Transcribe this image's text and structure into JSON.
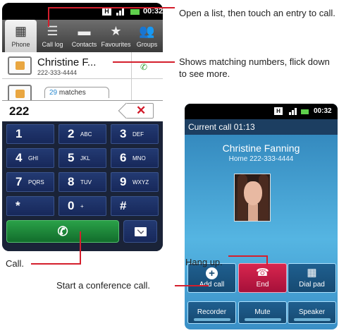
{
  "dialer": {
    "status": {
      "h_badge": "H",
      "time": "00:32"
    },
    "tabs": [
      {
        "label": "Phone",
        "icon": "keypad-icon",
        "active": true
      },
      {
        "label": "Call log",
        "icon": "list-icon"
      },
      {
        "label": "Contacts",
        "icon": "contacts-icon"
      },
      {
        "label": "Favourites",
        "icon": "star-icon"
      },
      {
        "label": "Groups",
        "icon": "groups-icon"
      }
    ],
    "entry": {
      "name": "Christine F...",
      "number": "222-333-4444"
    },
    "matches": {
      "count": "29",
      "label": "matches"
    },
    "input": {
      "value": "222",
      "delete_symbol": "✕"
    },
    "keys": [
      {
        "digit": "1",
        "letters": ""
      },
      {
        "digit": "2",
        "letters": "ABC"
      },
      {
        "digit": "3",
        "letters": "DEF"
      },
      {
        "digit": "4",
        "letters": "GHI"
      },
      {
        "digit": "5",
        "letters": "JKL"
      },
      {
        "digit": "6",
        "letters": "MNO"
      },
      {
        "digit": "7",
        "letters": "PQRS"
      },
      {
        "digit": "8",
        "letters": "TUV"
      },
      {
        "digit": "9",
        "letters": "WXYZ"
      },
      {
        "digit": "*",
        "letters": ""
      },
      {
        "digit": "0",
        "letters": "+"
      },
      {
        "digit": "#",
        "letters": ""
      }
    ]
  },
  "incall": {
    "status": {
      "h_badge": "H",
      "time": "00:32"
    },
    "current_call": "Current call 01:13",
    "contact_name": "Christine Fanning",
    "contact_number": "Home 222-333-4444",
    "buttons": {
      "add_call": "Add call",
      "end": "End",
      "dial_pad": "Dial pad",
      "recorder": "Recorder",
      "mute": "Mute",
      "speaker": "Speaker"
    }
  },
  "callouts": {
    "open_list": "Open a list, then touch an entry to call.",
    "matching": "Shows matching numbers, flick down to see more.",
    "call": "Call.",
    "hang_up": "Hang up.",
    "conference": "Start a conference call."
  },
  "colors": {
    "callout_line": "#d41f2d",
    "call_green": "#2aa148",
    "end_red": "#d8264e"
  }
}
